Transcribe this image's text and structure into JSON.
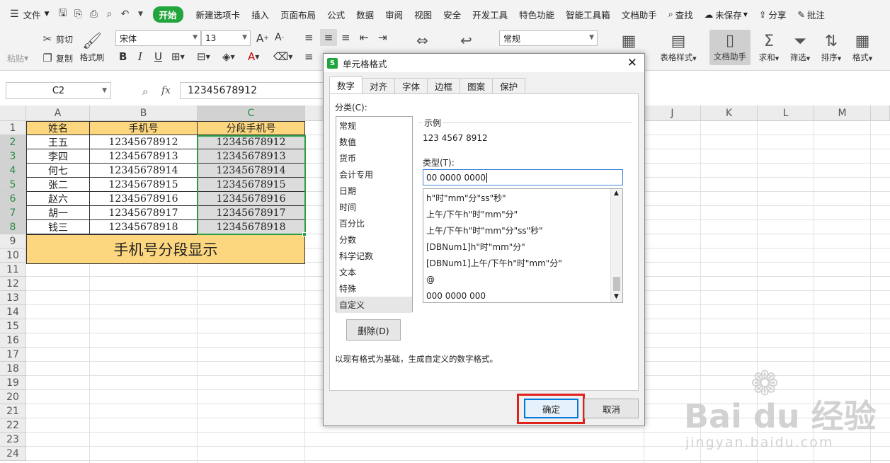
{
  "menu": {
    "file": "文件",
    "tabs": [
      "开始",
      "新建选项卡",
      "插入",
      "页面布局",
      "公式",
      "数据",
      "审阅",
      "视图",
      "安全",
      "开发工具",
      "特色功能",
      "智能工具箱",
      "文档助手"
    ],
    "search": "查找",
    "unsaved": "未保存",
    "share": "分享",
    "comment": "批注"
  },
  "ribbon": {
    "paste": "粘贴",
    "cut": "剪切",
    "copy": "复制",
    "format_painter": "格式刷",
    "font_name": "宋体",
    "font_size": "13",
    "number_format": "常规",
    "table_style": "表格样式",
    "doc_helper": "文档助手",
    "sum": "求和",
    "filter": "筛选",
    "sort": "排序",
    "format": "格式"
  },
  "formula_bar": {
    "name_box": "C2",
    "fx": "fx",
    "value": "12345678912"
  },
  "sheet": {
    "columns": [
      "A",
      "B",
      "C",
      "J",
      "K",
      "L",
      "M"
    ],
    "rows": [
      "1",
      "2",
      "3",
      "4",
      "5",
      "6",
      "7",
      "8",
      "9",
      "10",
      "11",
      "12",
      "13",
      "14",
      "15",
      "16",
      "17",
      "18",
      "19",
      "20",
      "21",
      "22",
      "23",
      "24"
    ],
    "headers": [
      "姓名",
      "手机号",
      "分段手机号"
    ],
    "data": [
      [
        "王五",
        "12345678912",
        "12345678912"
      ],
      [
        "李四",
        "12345678913",
        "12345678913"
      ],
      [
        "何七",
        "12345678914",
        "12345678914"
      ],
      [
        "张二",
        "12345678915",
        "12345678915"
      ],
      [
        "赵六",
        "12345678916",
        "12345678916"
      ],
      [
        "胡一",
        "12345678917",
        "12345678917"
      ],
      [
        "钱三",
        "12345678918",
        "12345678918"
      ]
    ],
    "merged_title": "手机号分段显示"
  },
  "dialog": {
    "title": "单元格格式",
    "tabs": [
      "数字",
      "对齐",
      "字体",
      "边框",
      "图案",
      "保护"
    ],
    "category_label": "分类(C):",
    "categories": [
      "常规",
      "数值",
      "货币",
      "会计专用",
      "日期",
      "时间",
      "百分比",
      "分数",
      "科学记数",
      "文本",
      "特殊",
      "自定义"
    ],
    "sample_label": "示例",
    "sample_value": "123 4567 8912",
    "type_label": "类型(T):",
    "type_value": "00 0000 0000",
    "type_list": [
      "h\"时\"mm\"分\"ss\"秒\"",
      "上午/下午h\"时\"mm\"分\"",
      "上午/下午h\"时\"mm\"分\"ss\"秒\"",
      "[DBNum1]h\"时\"mm\"分\"",
      "[DBNum1]上午/下午h\"时\"mm\"分\"",
      "@",
      "000 0000 000"
    ],
    "delete": "删除(D)",
    "description": "以现有格式为基础，生成自定义的数字格式。",
    "ok": "确定",
    "cancel": "取消"
  },
  "watermark": {
    "text": "Bai du 经验",
    "url": "jingyan.baidu.com"
  },
  "colors": {
    "accent_green": "#23a53d",
    "header_fill": "#fdd77f",
    "highlight_red": "#e0201b"
  }
}
